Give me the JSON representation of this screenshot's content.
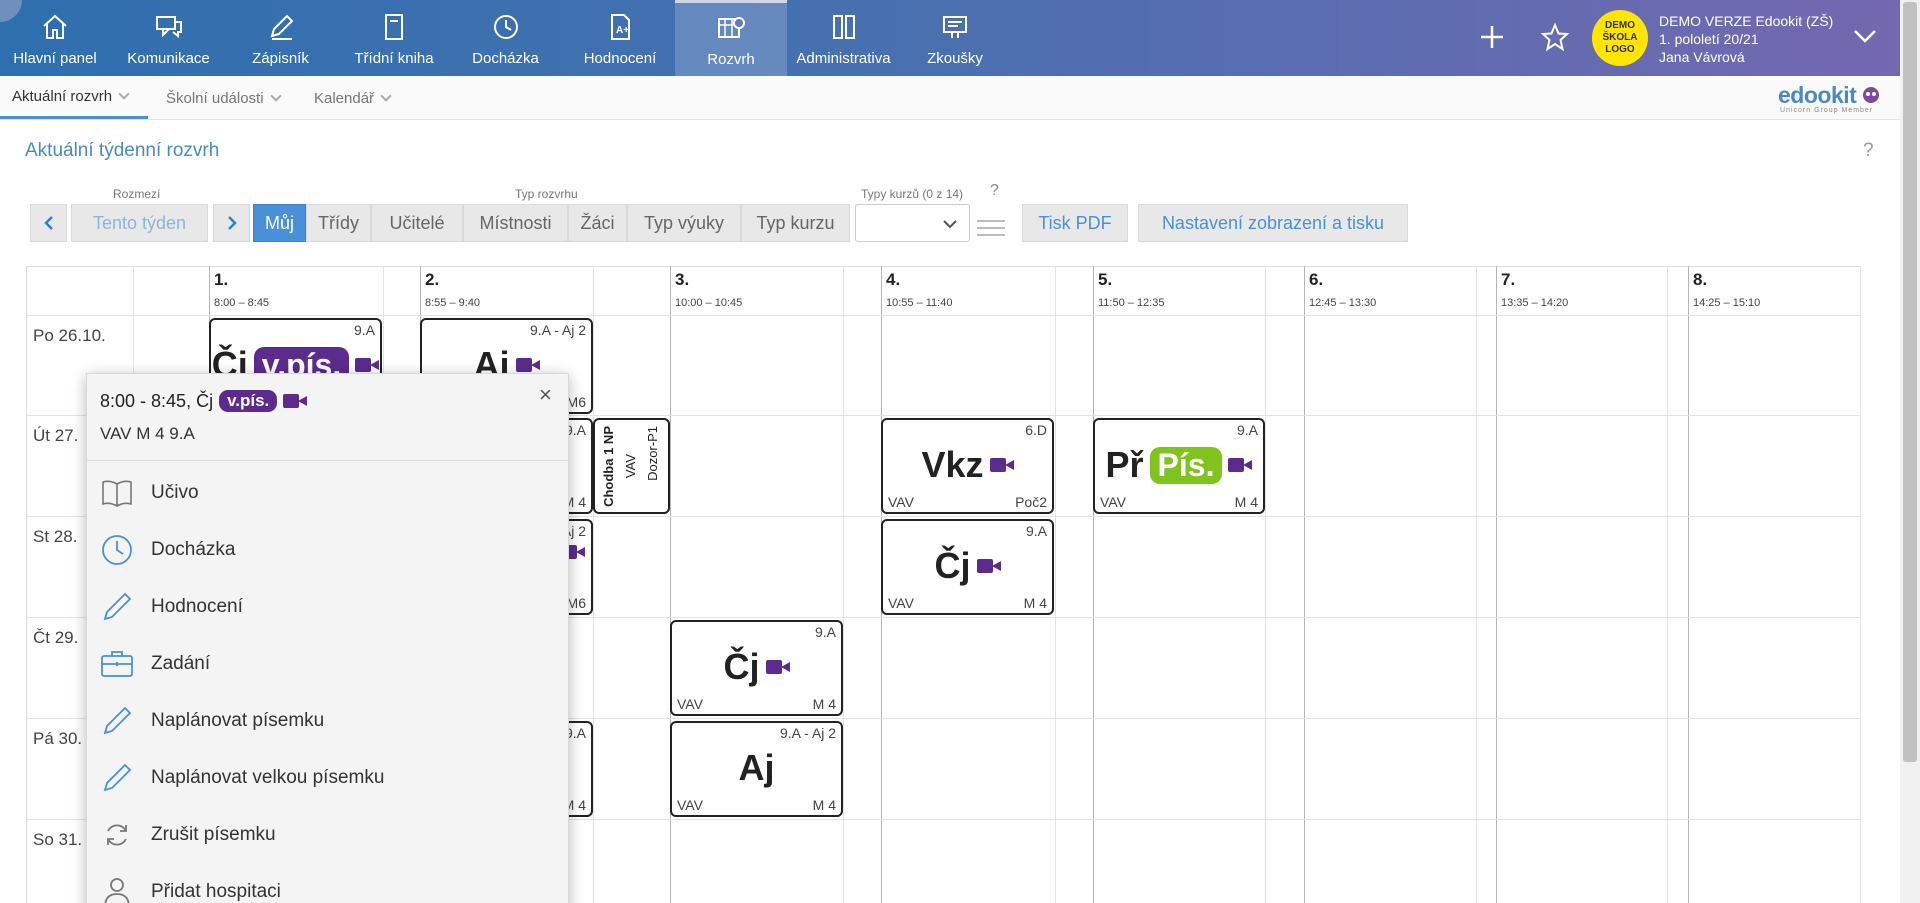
{
  "nav": {
    "items": [
      {
        "label": "Hlavní panel",
        "icon": "home-icon"
      },
      {
        "label": "Komunikace",
        "icon": "chat-icon"
      },
      {
        "label": "Zápisník",
        "icon": "pen-icon"
      },
      {
        "label": "Třídní kniha",
        "icon": "book-icon"
      },
      {
        "label": "Docházka",
        "icon": "clock-icon"
      },
      {
        "label": "Hodnocení",
        "icon": "grade-file-icon"
      },
      {
        "label": "Rozvrh",
        "icon": "schedule-icon"
      },
      {
        "label": "Administrativa",
        "icon": "binders-icon"
      },
      {
        "label": "Zkoušky",
        "icon": "exam-icon"
      }
    ],
    "active": "Rozvrh"
  },
  "header": {
    "logo_text": "DEMO ŠKOLA LOGO",
    "school": "DEMO VERZE Edookit (ZŠ)",
    "term": "1. pololetí 20/21",
    "user": "Jana Vávrová"
  },
  "subnav": {
    "items": [
      "Aktuální rozvrh",
      "Školní události",
      "Kalendář"
    ],
    "brand": "edookit",
    "brand_sub": "Unicorn Group Member"
  },
  "page": {
    "title": "Aktuální týdenní rozvrh",
    "help": "?"
  },
  "toolbar": {
    "range_label": "Rozmezí",
    "range_value": "Tento týden",
    "type_label": "Typ rozvrhu",
    "types": [
      "Můj",
      "Třídy",
      "Učitelé",
      "Místnosti",
      "Žáci",
      "Typ výuky",
      "Typ kurzu"
    ],
    "course_label": "Typy kurzů",
    "course_count": "(0 z 14)",
    "course_help": "?",
    "pdf": "Tisk PDF",
    "settings": "Nastavení zobrazení a tisku"
  },
  "periods": [
    {
      "num": "1.",
      "time": "8:00 – 8:45"
    },
    {
      "num": "2.",
      "time": "8:55 – 9:40"
    },
    {
      "num": "3.",
      "time": "10:00 – 10:45"
    },
    {
      "num": "4.",
      "time": "10:55 – 11:40"
    },
    {
      "num": "5.",
      "time": "11:50 – 12:35"
    },
    {
      "num": "6.",
      "time": "12:45 – 13:30"
    },
    {
      "num": "7.",
      "time": "13:35 – 14:20"
    },
    {
      "num": "8.",
      "time": "14:25 – 15:10"
    }
  ],
  "days": [
    "Po 26.10.",
    "Út 27.",
    "St 28.",
    "Čt 29.",
    "Pá 30.",
    "So 31."
  ],
  "lessons": [
    {
      "cls": "9.A",
      "subject": "Čj",
      "tag": "v.pís.",
      "left": "",
      "right": ""
    },
    {
      "cls": "9.A - Aj 2",
      "subject": "Aj",
      "left": "",
      "right": "M6"
    },
    {
      "cls": "9.A",
      "left": "",
      "right": "M 4"
    },
    {
      "duty_1": "Chodba 1 NP",
      "duty_2": "VAV",
      "duty_3": "Dozor-P1"
    },
    {
      "cls": "6.D",
      "subject": "Vkz",
      "left": "VAV",
      "right": "Poč2"
    },
    {
      "cls": "9.A",
      "subject": "Př",
      "tag": "Pís.",
      "left": "VAV",
      "right": "M 4"
    },
    {
      "cls": "Aj 2",
      "left": "",
      "right": "M6"
    },
    {
      "cls": "9.A",
      "subject": "Čj",
      "left": "VAV",
      "right": "M 4"
    },
    {
      "cls": "9.A",
      "subject": "Čj",
      "left": "VAV",
      "right": "M 4"
    },
    {
      "cls": "9.A",
      "left": "",
      "right": "M 4"
    },
    {
      "cls": "9.A - Aj 2",
      "subject": "Aj",
      "left": "VAV",
      "right": "M 4"
    }
  ],
  "popup": {
    "time": "8:00 - 8:45, Čj",
    "tag": "v.pís.",
    "sub": "VAV M 4 9.A",
    "close": "×",
    "menu": [
      {
        "label": "Učivo",
        "icon": "open-book-icon"
      },
      {
        "label": "Docházka",
        "icon": "clock-icon"
      },
      {
        "label": "Hodnocení",
        "icon": "pencil-icon"
      },
      {
        "label": "Zadání",
        "icon": "briefcase-icon"
      },
      {
        "label": "Naplánovat písemku",
        "icon": "pencil-icon"
      },
      {
        "label": "Naplánovat velkou písemku",
        "icon": "pencil-icon"
      },
      {
        "label": "Zrušit písemku",
        "icon": "refresh-icon"
      },
      {
        "label": "Přidat hospitaci",
        "icon": "person-icon"
      }
    ]
  },
  "colors": {
    "accent": "#4a90d9",
    "test_tag": "#5b2c8e",
    "exam_tag": "#7fc31c",
    "logo": "#ffe500"
  }
}
